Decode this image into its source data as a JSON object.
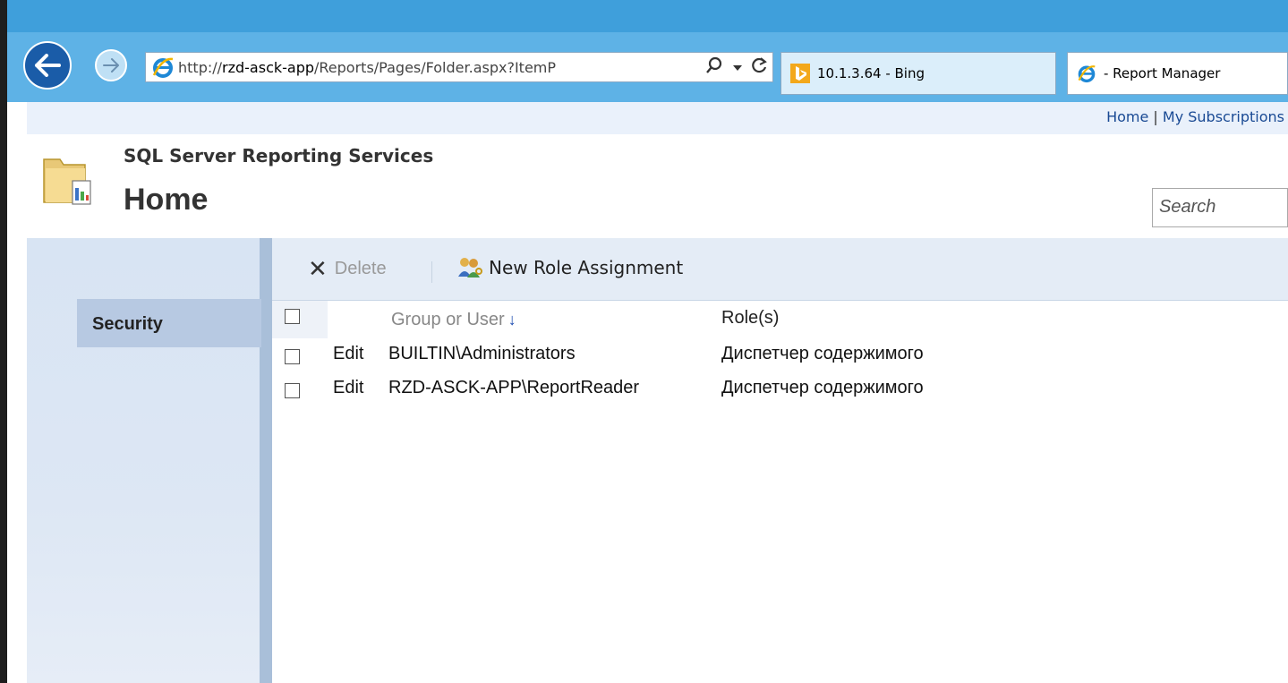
{
  "browser": {
    "url_prefix": "http://",
    "url_host": "rzd-asck-app",
    "url_path": "/Reports/Pages/Folder.aspx?ItemP",
    "tabs": [
      {
        "label": "10.1.3.64 - Bing"
      },
      {
        "label": "- Report Manager"
      }
    ]
  },
  "toplinks": {
    "home": "Home",
    "separator": " | ",
    "subscriptions": "My Subscriptions"
  },
  "header": {
    "app_title": "SQL Server Reporting Services",
    "page_title": "Home",
    "search_placeholder": "Search"
  },
  "sidebar": {
    "items": [
      {
        "label": "Security"
      }
    ]
  },
  "toolbar": {
    "delete_label": "Delete",
    "new_role_label": "New Role Assignment"
  },
  "table": {
    "columns": [
      "Group or User",
      "Role(s)"
    ],
    "sort_indicator": "↓",
    "rows": [
      {
        "action": "Edit",
        "user": "BUILTIN\\Administrators",
        "role": "Диспетчер содержимого"
      },
      {
        "action": "Edit",
        "user": "RZD-ASCK-APP\\ReportReader",
        "role": "Диспетчер содержимого"
      }
    ]
  },
  "colors": {
    "titlebar": "#3f9fdb",
    "sidebar_selected": "#b7c9e2",
    "link": "#1a4a94"
  }
}
